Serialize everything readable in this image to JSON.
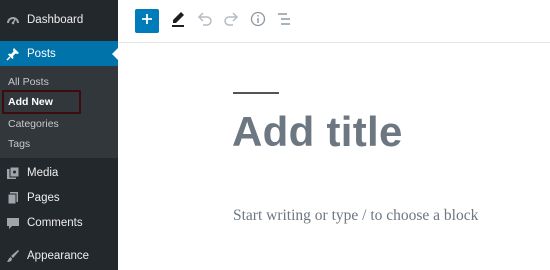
{
  "sidebar": {
    "dashboard": {
      "label": "Dashboard",
      "icon": "dashboard-icon"
    },
    "posts": {
      "label": "Posts",
      "icon": "pin-icon",
      "active": true,
      "submenu": {
        "all_posts": "All Posts",
        "add_new": "Add New",
        "categories": "Categories",
        "tags": "Tags"
      }
    },
    "media": {
      "label": "Media",
      "icon": "media-icon"
    },
    "pages": {
      "label": "Pages",
      "icon": "pages-icon"
    },
    "comments": {
      "label": "Comments",
      "icon": "comment-icon"
    },
    "appearance": {
      "label": "Appearance",
      "icon": "paintbrush-icon"
    }
  },
  "toolbar": {
    "add_block": "+",
    "icons": [
      "plus-icon",
      "pen-icon",
      "undo-icon",
      "redo-icon",
      "info-icon",
      "outline-icon"
    ]
  },
  "editor": {
    "title_placeholder": "Add title",
    "body_placeholder": "Start writing or type / to choose a block"
  },
  "colors": {
    "sidebar_bg": "#23282d",
    "submenu_bg": "#32373c",
    "accent": "#0073aa",
    "button": "#007cba",
    "placeholder": "#6c7781",
    "highlight_border": "#3b0d0d"
  }
}
